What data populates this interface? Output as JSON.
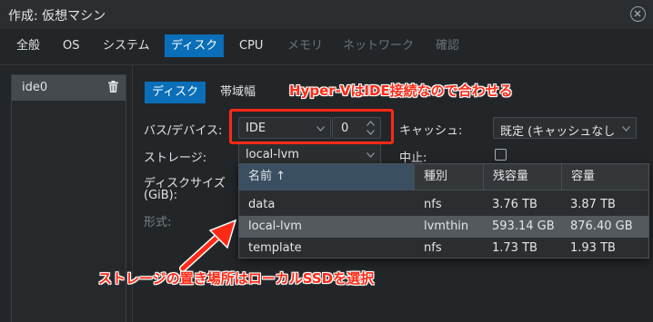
{
  "window": {
    "title": "作成: 仮想マシン"
  },
  "tabs": [
    {
      "label": "全般",
      "state": "normal"
    },
    {
      "label": "OS",
      "state": "normal"
    },
    {
      "label": "システム",
      "state": "normal"
    },
    {
      "label": "ディスク",
      "state": "active"
    },
    {
      "label": "CPU",
      "state": "normal"
    },
    {
      "label": "メモリ",
      "state": "disabled"
    },
    {
      "label": "ネットワーク",
      "state": "disabled"
    },
    {
      "label": "確認",
      "state": "disabled"
    }
  ],
  "disk_list": {
    "items": [
      {
        "label": "ide0",
        "icon": "trash-icon"
      }
    ]
  },
  "sub_tabs": [
    {
      "label": "ディスク",
      "state": "active"
    },
    {
      "label": "帯域幅",
      "state": "normal"
    }
  ],
  "form": {
    "bus_device_label": "バス/デバイス:",
    "bus_value": "IDE",
    "device_number": "0",
    "cache_label": "キャッシュ:",
    "cache_value": "既定 (キャッシュなし",
    "storage_label": "ストレージ:",
    "storage_value": "local-lvm",
    "discard_label": "中止:",
    "discard_checked": false,
    "disk_size_label_line1": "ディスクサイズ",
    "disk_size_label_line2": "(GiB):",
    "format_label": "形式:"
  },
  "storage_dropdown": {
    "columns": [
      "名前 ↑",
      "種別",
      "残容量",
      "容量"
    ],
    "rows": [
      {
        "name": "data",
        "type": "nfs",
        "avail": "3.76 TB",
        "capacity": "3.87 TB",
        "selected": false
      },
      {
        "name": "local-lvm",
        "type": "lvmthin",
        "avail": "593.14 GB",
        "capacity": "876.40 GB",
        "selected": true
      },
      {
        "name": "template",
        "type": "nfs",
        "avail": "1.73 TB",
        "capacity": "1.93 TB",
        "selected": false
      }
    ]
  },
  "annotations": {
    "top": "Hyper-VはIDE接続なので合わせる",
    "bottom": "ストレージの置き場所はローカルSSDを選択",
    "color": "#ff2a16"
  },
  "colors": {
    "accent": "#0a6eb8",
    "background": "#232628",
    "selected_row": "#54595e"
  }
}
